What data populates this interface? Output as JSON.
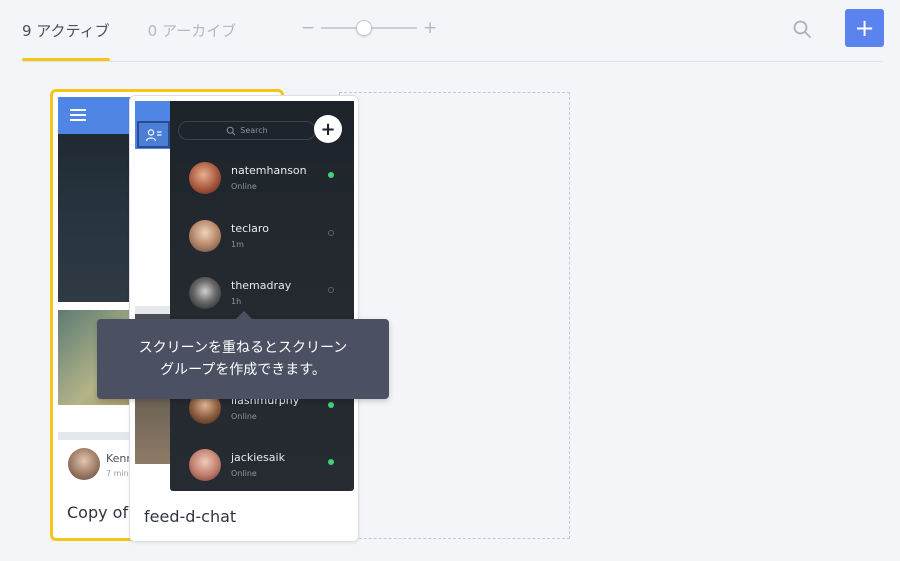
{
  "tabs": [
    {
      "label": "9 アクティブ",
      "active": true
    },
    {
      "label": "0 アーカイブ",
      "active": false
    }
  ],
  "zoom": {
    "minus": "−",
    "plus": "+",
    "level": 0.45
  },
  "toolbar": {
    "add_label": "+",
    "search_icon": "search-icon"
  },
  "colors": {
    "accent": "#f5c518",
    "primary": "#5b83f0",
    "tooltip_bg": "#4b5162",
    "online": "#3ed27a"
  },
  "back_card": {
    "author": "Kenn",
    "time": "7 minu",
    "title": "Copy of"
  },
  "front_card": {
    "title": "feed-d-chat",
    "chat": {
      "search_placeholder": "Search",
      "add_label": "+",
      "contacts": [
        {
          "name": "natemhanson",
          "status": "Online",
          "online": true
        },
        {
          "name": "teclaro",
          "status": "1m",
          "online": false
        },
        {
          "name": "themadray",
          "status": "1h",
          "online": false
        },
        {
          "name": "llashmurphy",
          "status": "Online",
          "online": true
        },
        {
          "name": "jackiesaik",
          "status": "Online",
          "online": true
        }
      ]
    }
  },
  "tooltip": {
    "line1": "スクリーンを重ねるとスクリーン",
    "line2": "グループを作成できます。"
  }
}
